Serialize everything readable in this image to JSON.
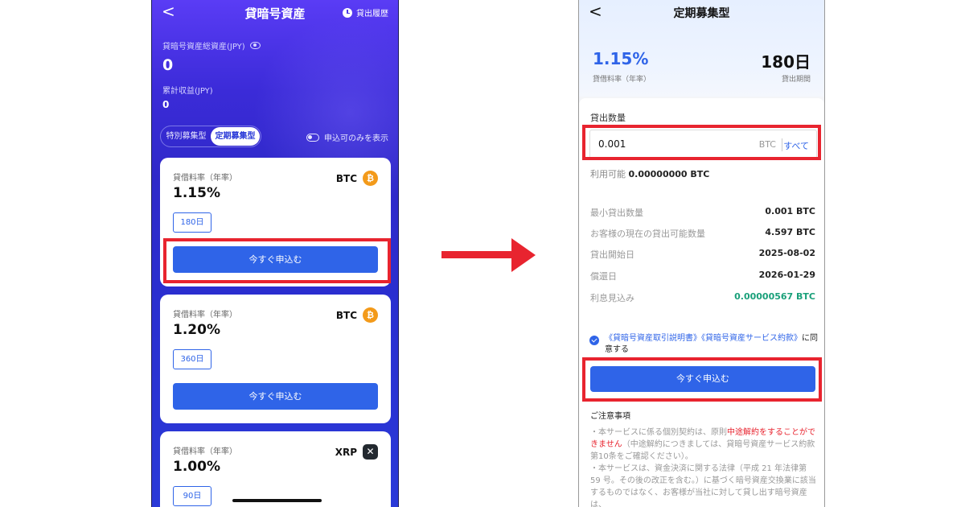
{
  "left": {
    "back": "<",
    "title": "貸暗号資産",
    "history_label": "貸出履歴",
    "total_label": "貸暗号資産総資産(JPY)",
    "total_value": "0",
    "profit_label": "累計収益(JPY)",
    "profit_value": "0",
    "tabs": [
      "特別募集型",
      "定期募集型"
    ],
    "active_tab": "定期募集型",
    "toggle_label": "申込可のみを表示",
    "cards": [
      {
        "rate_label": "貸借料率（年率）",
        "rate": "1.15%",
        "coin": "BTC",
        "coin_symbol": "₿",
        "term": "180日",
        "button": "今すぐ申込む"
      },
      {
        "rate_label": "貸借料率（年率）",
        "rate": "1.20%",
        "coin": "BTC",
        "coin_symbol": "₿",
        "term": "360日",
        "button": "今すぐ申込む"
      },
      {
        "rate_label": "貸借料率（年率）",
        "rate": "1.00%",
        "coin": "XRP",
        "coin_symbol": "✕",
        "term": "90日"
      }
    ]
  },
  "right": {
    "back": "<",
    "title": "定期募集型",
    "rate": "1.15%",
    "rate_label": "貸借料率（年率）",
    "days": "180日",
    "days_label": "貸出期間",
    "qty_label": "貸出数量",
    "input_value": "0.001",
    "input_unit": "BTC",
    "all_label": "すべて",
    "avail_label": "利用可能",
    "avail_value": "0.00000000 BTC",
    "details": [
      {
        "k": "最小貸出数量",
        "v": "0.001 BTC"
      },
      {
        "k": "お客様の現在の貸出可能数量",
        "v": "4.597 BTC"
      },
      {
        "k": "貸出開始日",
        "v": "2025-08-02"
      },
      {
        "k": "償還日",
        "v": "2026-01-29"
      },
      {
        "k": "利息見込み",
        "v": "0.00000567 BTC"
      }
    ],
    "agree_link": "《貸暗号資産取引説明書》《貸暗号資産サービス約款》",
    "agree_suffix": "に同意する",
    "button": "今すぐ申込む",
    "notes_title": "ご注意事項",
    "note1_a": "・本サービスに係る個別契約は、原則",
    "note1_red": "中途解約をすることができません",
    "note1_b": "（中途解約につきましては、貸暗号資産サービス約款第10条をご確認ください）。",
    "note2": "・本サービスは、資金決済に関する法律（平成 21 年法律第 59 号。その後の改正を含む。）に基づく暗号資産交換業に該当するものではなく、お客様が当社に対して貸し出す暗号資産は、"
  },
  "colors": {
    "accent": "#2f64e8",
    "highlight": "#e8242f",
    "btc": "#f39a1a",
    "green": "#1aa07a"
  }
}
